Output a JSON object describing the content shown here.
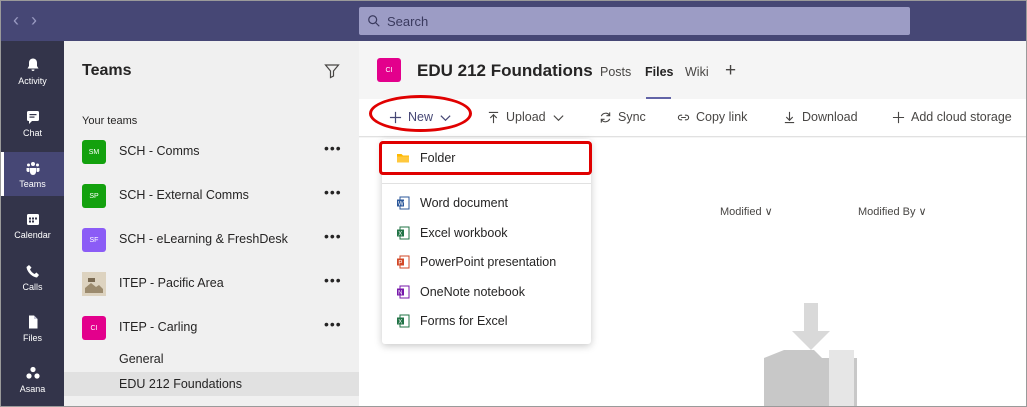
{
  "search": {
    "placeholder": "Search"
  },
  "rail": [
    {
      "label": "Activity",
      "icon": "bell-icon"
    },
    {
      "label": "Chat",
      "icon": "chat-icon"
    },
    {
      "label": "Teams",
      "icon": "teams-icon"
    },
    {
      "label": "Calendar",
      "icon": "calendar-icon"
    },
    {
      "label": "Calls",
      "icon": "phone-icon"
    },
    {
      "label": "Files",
      "icon": "file-icon"
    },
    {
      "label": "Asana",
      "icon": "asana-icon"
    }
  ],
  "teams_panel": {
    "title": "Teams",
    "section_label": "Your teams",
    "teams": [
      {
        "initials": "SM",
        "name": "SCH - Comms",
        "color": "#13a10e"
      },
      {
        "initials": "SP",
        "name": "SCH - External Comms",
        "color": "#13a10e"
      },
      {
        "initials": "SF",
        "name": "SCH - eLearning & FreshDesk",
        "color": "#8b5cf6"
      },
      {
        "initials": "",
        "name": "ITEP - Pacific Area",
        "color": "#c9b79c"
      },
      {
        "initials": "CI",
        "name": "ITEP - Carling",
        "color": "#e3008c"
      }
    ],
    "more_label": "•••",
    "channels": [
      "General",
      "EDU 212 Foundations"
    ]
  },
  "header": {
    "avatar_initials": "CI",
    "title": "EDU 212 Foundations",
    "tabs": [
      "Posts",
      "Files",
      "Wiki"
    ],
    "active_tab": "Files",
    "add_tab": "+"
  },
  "toolbar": {
    "new_label": "New",
    "upload_label": "Upload",
    "sync_label": "Sync",
    "copy_link_label": "Copy link",
    "download_label": "Download",
    "add_storage_label": "Add cloud storage"
  },
  "columns": {
    "modified": "Modified",
    "modified_by": "Modified By"
  },
  "new_menu": {
    "items": [
      {
        "label": "Folder",
        "icon": "folder-icon",
        "color": "#ffb900"
      },
      {
        "label": "Word document",
        "icon": "word-icon",
        "color": "#2b579a"
      },
      {
        "label": "Excel workbook",
        "icon": "excel-icon",
        "color": "#217346"
      },
      {
        "label": "PowerPoint presentation",
        "icon": "powerpoint-icon",
        "color": "#d24726"
      },
      {
        "label": "OneNote notebook",
        "icon": "onenote-icon",
        "color": "#7719aa"
      },
      {
        "label": "Forms for Excel",
        "icon": "forms-excel-icon",
        "color": "#217346"
      }
    ]
  }
}
